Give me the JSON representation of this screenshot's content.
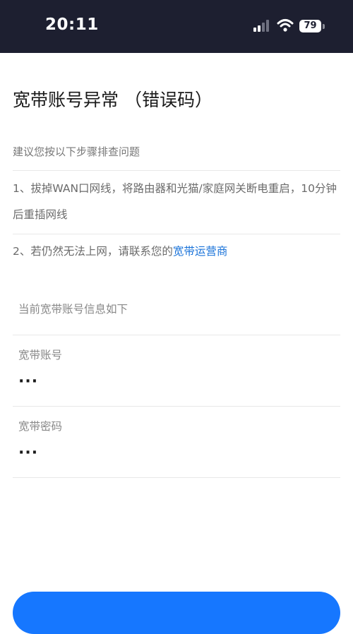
{
  "status_bar": {
    "time": "20:11",
    "battery": "79",
    "icons": [
      "signal-icon",
      "wifi-icon",
      "battery-icon"
    ]
  },
  "page": {
    "title": "宽带账号异常 （错误码）",
    "intro": "建议您按以下步骤排查问题",
    "steps": [
      {
        "text": "1、拔掉WAN口网线，将路由器和光猫/家庭网关断电重启，10分钟后重插网线"
      },
      {
        "text": "2、若仍然无法上网，请联系您的",
        "link": "宽带运营商"
      }
    ]
  },
  "account_info": {
    "heading": "当前宽带账号信息如下",
    "fields": [
      {
        "label": "宽带账号",
        "value": "···"
      },
      {
        "label": "宽带密码",
        "value": "···"
      }
    ]
  },
  "colors": {
    "status_bar_bg": "#1d1f30",
    "link": "#1a73d9",
    "primary_button": "#1677ff"
  }
}
